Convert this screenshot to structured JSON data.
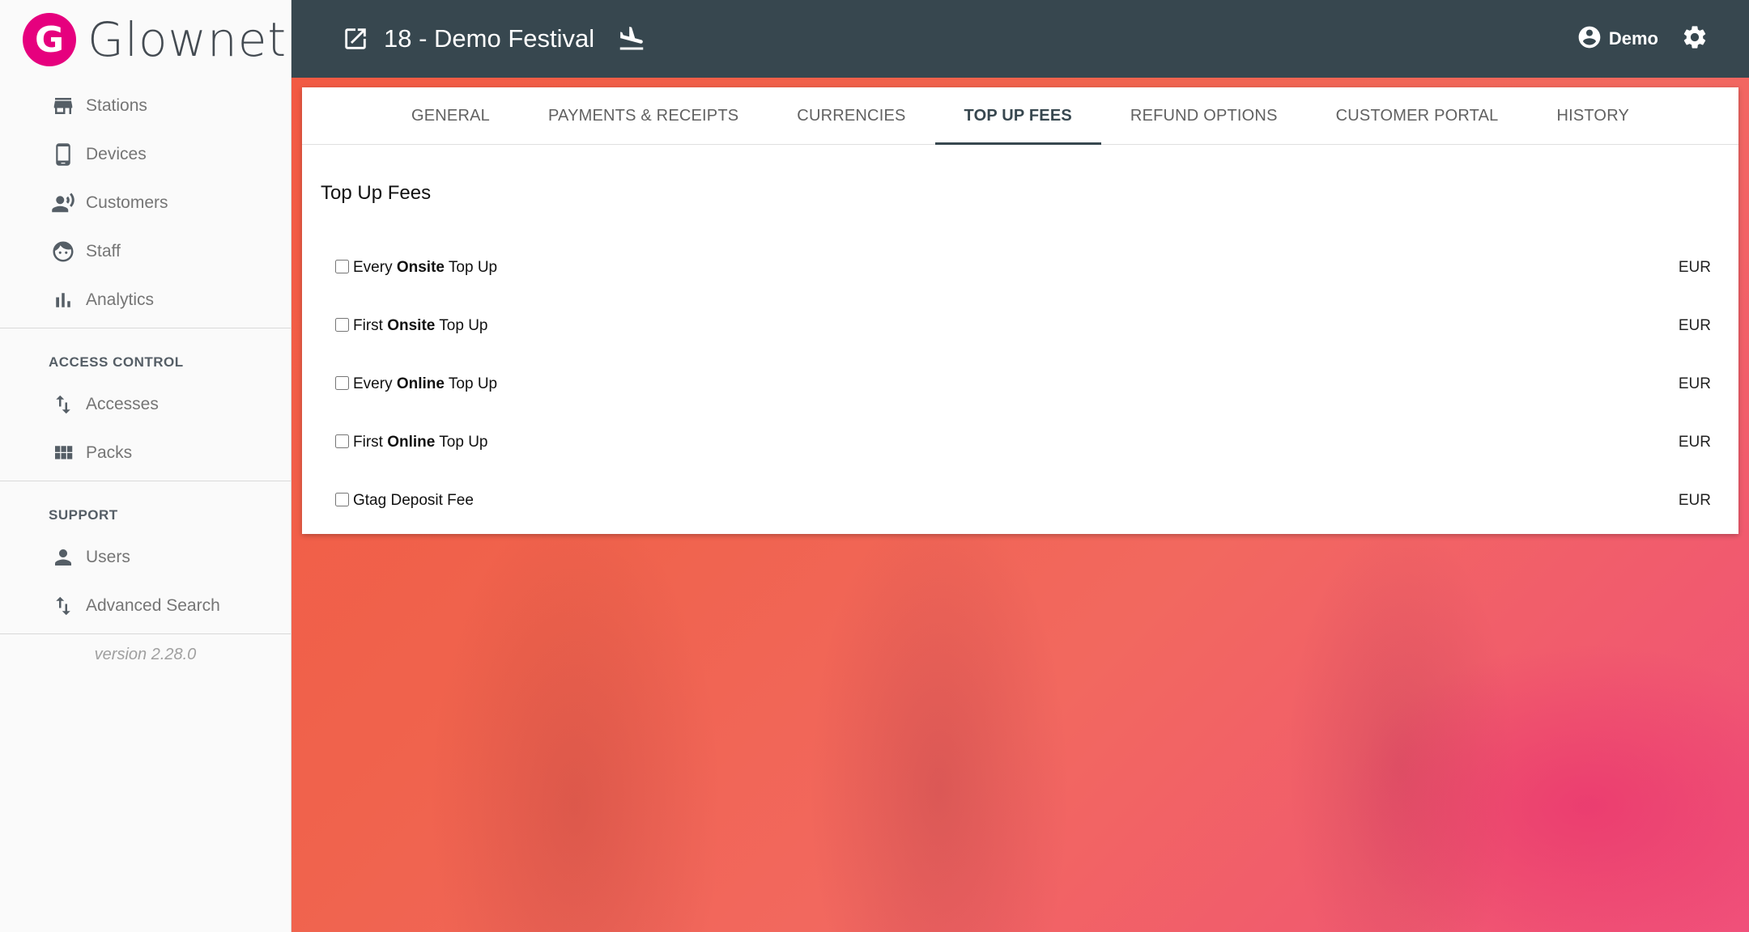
{
  "brand": {
    "logo_letter": "G",
    "name": "Glownet",
    "color": "#e6007e"
  },
  "sidebar": {
    "main_items": [
      {
        "label": "Stations",
        "icon": "store-icon"
      },
      {
        "label": "Devices",
        "icon": "phone-icon"
      },
      {
        "label": "Customers",
        "icon": "customers-icon"
      },
      {
        "label": "Staff",
        "icon": "face-icon"
      },
      {
        "label": "Analytics",
        "icon": "bar-chart-icon"
      }
    ],
    "access_control": {
      "title": "ACCESS CONTROL",
      "items": [
        {
          "label": "Accesses",
          "icon": "swap-vertical-icon"
        },
        {
          "label": "Packs",
          "icon": "grid-icon"
        }
      ]
    },
    "support": {
      "title": "SUPPORT",
      "items": [
        {
          "label": "Users",
          "icon": "person-icon"
        },
        {
          "label": "Advanced Search",
          "icon": "swap-vertical-icon"
        }
      ]
    },
    "version": "version 2.28.0"
  },
  "header": {
    "event_title": "18 - Demo Festival",
    "user_name": "Demo",
    "bg_color": "#37474f"
  },
  "tabs": [
    {
      "label": "GENERAL",
      "active": false
    },
    {
      "label": "PAYMENTS & RECEIPTS",
      "active": false
    },
    {
      "label": "CURRENCIES",
      "active": false
    },
    {
      "label": "TOP UP FEES",
      "active": true
    },
    {
      "label": "REFUND OPTIONS",
      "active": false
    },
    {
      "label": "CUSTOMER PORTAL",
      "active": false
    },
    {
      "label": "HISTORY",
      "active": false
    }
  ],
  "card": {
    "title": "Top Up Fees",
    "fees": [
      {
        "pre": "Every ",
        "bold": "Onsite",
        "post": " Top Up",
        "currency": "EUR",
        "checked": false
      },
      {
        "pre": "First ",
        "bold": "Onsite",
        "post": " Top Up",
        "currency": "EUR",
        "checked": false
      },
      {
        "pre": "Every ",
        "bold": "Online",
        "post": " Top Up",
        "currency": "EUR",
        "checked": false
      },
      {
        "pre": "First ",
        "bold": "Online",
        "post": " Top Up",
        "currency": "EUR",
        "checked": false
      },
      {
        "pre": "Gtag Deposit Fee",
        "bold": "",
        "post": "",
        "currency": "EUR",
        "checked": false
      }
    ]
  }
}
